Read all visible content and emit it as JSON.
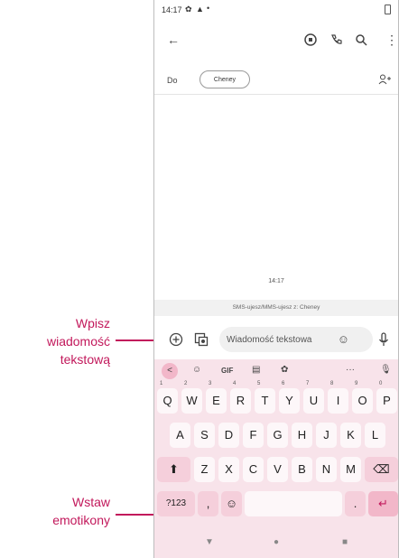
{
  "status_bar": {
    "time": "14:17",
    "icons": [
      "gear-icon",
      "warning-icon",
      "dot-icon",
      "battery-icon"
    ]
  },
  "top_bar": {
    "back_icon": "←",
    "icons": [
      "sticker-icon",
      "phone-icon",
      "search-icon",
      "more-vert-icon"
    ]
  },
  "to_row": {
    "label": "Do",
    "chip": "Cheney",
    "add_icon": "add-person-icon"
  },
  "conversation": {
    "timestamp": "14:17",
    "note": "SMS-ujesz/MMS-ujesz z: Cheney"
  },
  "compose": {
    "placeholder": "Wiadomość tekstowa"
  },
  "keyboard": {
    "toolbar": [
      "<",
      "☺",
      "GIF",
      "▤",
      "✿",
      "···",
      "🎙"
    ],
    "row1": [
      {
        "k": "Q",
        "n": "1"
      },
      {
        "k": "W",
        "n": "2"
      },
      {
        "k": "E",
        "n": "3"
      },
      {
        "k": "R",
        "n": "4"
      },
      {
        "k": "T",
        "n": "5"
      },
      {
        "k": "Y",
        "n": "6"
      },
      {
        "k": "U",
        "n": "7"
      },
      {
        "k": "I",
        "n": "8"
      },
      {
        "k": "O",
        "n": "9"
      },
      {
        "k": "P",
        "n": "0"
      }
    ],
    "row2": [
      "A",
      "S",
      "D",
      "F",
      "G",
      "H",
      "J",
      "K",
      "L"
    ],
    "row3": [
      "Z",
      "X",
      "C",
      "V",
      "B",
      "N",
      "M"
    ],
    "bottom": {
      "num": "?123",
      "comma": ",",
      "period": "."
    }
  },
  "callouts": {
    "type_text": [
      "Wpisz",
      "wiadomość",
      "tekstową"
    ],
    "insert_emoji": [
      "Wstaw",
      "emotikony"
    ]
  },
  "colors": {
    "accent": "#c2185b",
    "keyboard_bg": "#f8e3ea"
  }
}
